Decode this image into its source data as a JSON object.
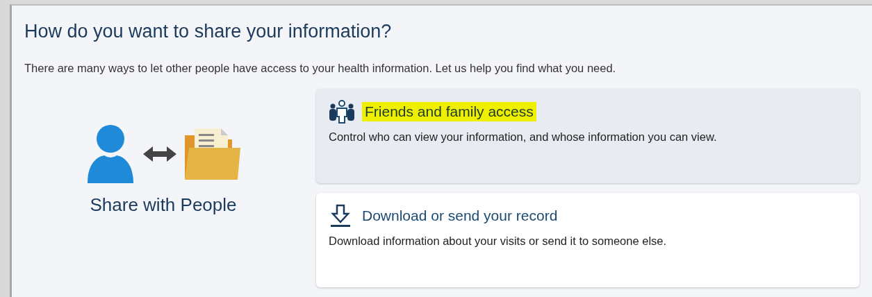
{
  "heading": "How do you want to share your information?",
  "intro": "There are many ways to let other people have access to your health information. Let us help you find what you need.",
  "illustration": {
    "caption": "Share with People"
  },
  "options": [
    {
      "kind": "people",
      "title": "Friends and family access",
      "description": "Control who can view your information, and whose information you can view.",
      "selected": true,
      "highlighted": true
    },
    {
      "kind": "download",
      "title": "Download or send your record",
      "description": "Download information about your visits or send it to someone else.",
      "selected": false,
      "highlighted": false
    }
  ]
}
